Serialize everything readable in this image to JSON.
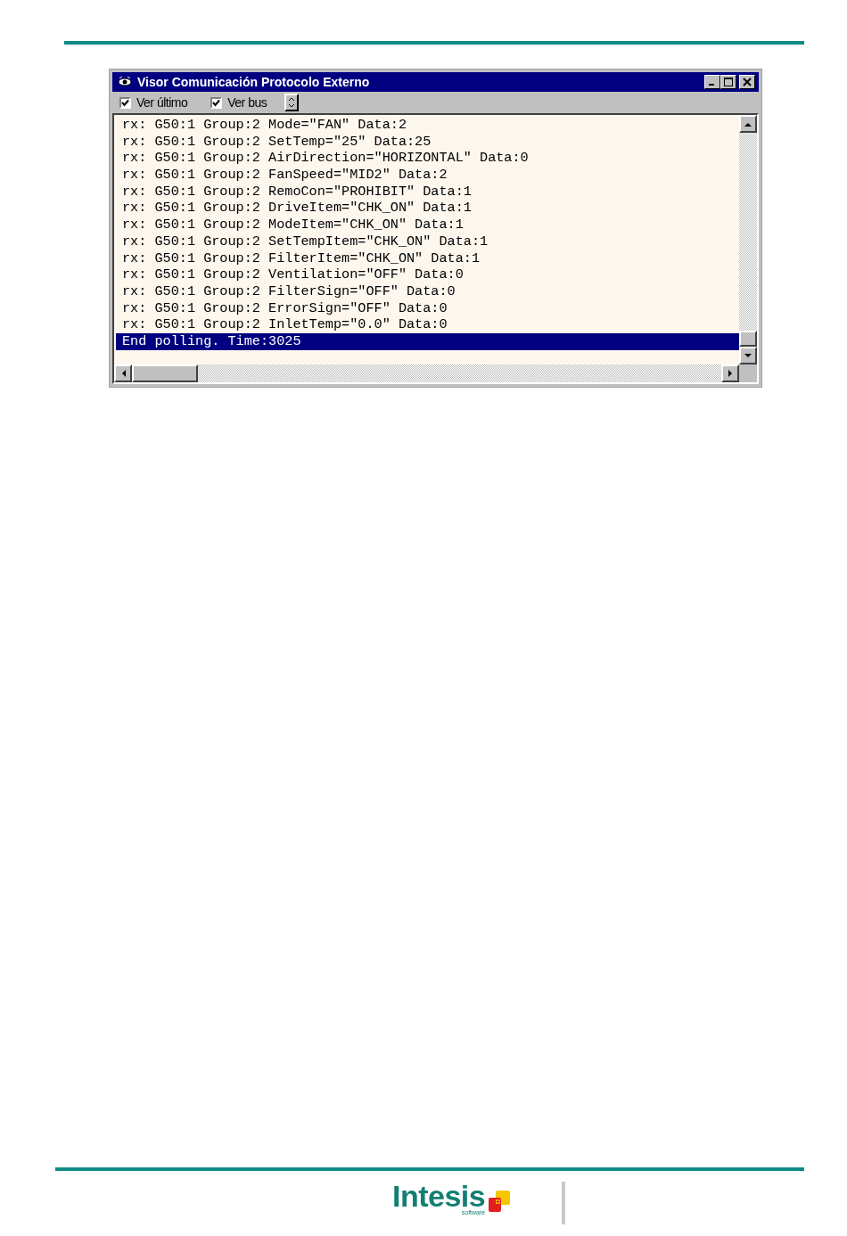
{
  "window": {
    "title": "Visor Comunicación Protocolo Externo"
  },
  "toolbar": {
    "checkboxes": [
      {
        "label": "Ver último",
        "checked": true
      },
      {
        "label": "Ver bus",
        "checked": true
      }
    ]
  },
  "log": {
    "lines": [
      {
        "text": "rx: G50:1 Group:2 Mode=\"FAN\" Data:2",
        "selected": false
      },
      {
        "text": "rx: G50:1 Group:2 SetTemp=\"25\" Data:25",
        "selected": false
      },
      {
        "text": "rx: G50:1 Group:2 AirDirection=\"HORIZONTAL\" Data:0",
        "selected": false
      },
      {
        "text": "rx: G50:1 Group:2 FanSpeed=\"MID2\" Data:2",
        "selected": false
      },
      {
        "text": "rx: G50:1 Group:2 RemoCon=\"PROHIBIT\" Data:1",
        "selected": false
      },
      {
        "text": "rx: G50:1 Group:2 DriveItem=\"CHK_ON\" Data:1",
        "selected": false
      },
      {
        "text": "rx: G50:1 Group:2 ModeItem=\"CHK_ON\" Data:1",
        "selected": false
      },
      {
        "text": "rx: G50:1 Group:2 SetTempItem=\"CHK_ON\" Data:1",
        "selected": false
      },
      {
        "text": "rx: G50:1 Group:2 FilterItem=\"CHK_ON\" Data:1",
        "selected": false
      },
      {
        "text": "rx: G50:1 Group:2 Ventilation=\"OFF\" Data:0",
        "selected": false
      },
      {
        "text": "rx: G50:1 Group:2 FilterSign=\"OFF\" Data:0",
        "selected": false
      },
      {
        "text": "rx: G50:1 Group:2 ErrorSign=\"OFF\" Data:0",
        "selected": false
      },
      {
        "text": "rx: G50:1 Group:2 InletTemp=\"0.0\" Data:0",
        "selected": false
      },
      {
        "text": "End polling. Time:3025",
        "selected": true
      }
    ]
  },
  "footer": {
    "logo": {
      "name": "Intesis",
      "tagline": "software"
    }
  }
}
